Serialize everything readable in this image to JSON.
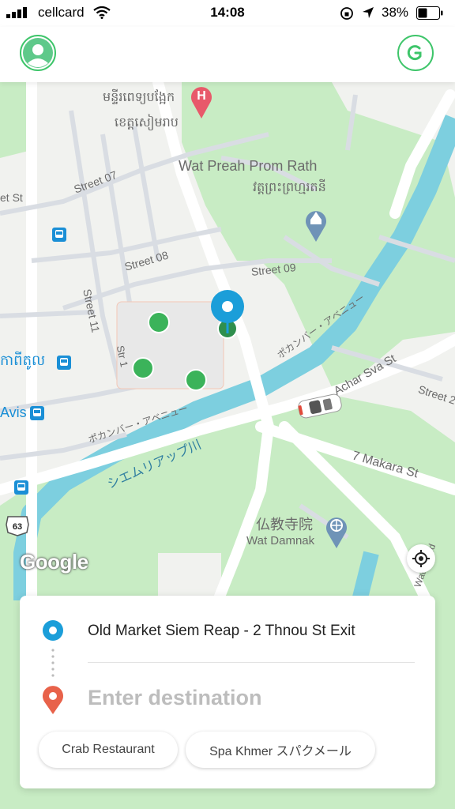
{
  "status_bar": {
    "carrier": "cellcard",
    "time": "14:08",
    "battery": "38%"
  },
  "map": {
    "labels": {
      "hospital_km_1": "មន្ទីរពេទ្យបង្អែក",
      "hospital_km_2": "ខេត្តសៀមរាប",
      "wat_preah_prom_rath": "Wat Preah Prom Rath",
      "wat_preah_prom_rath_km": "វត្តព្រះព្រហ្មរតនី",
      "street_07": "Street 07",
      "street_08": "Street 08",
      "street_09": "Street 09",
      "street_11": "Street 11",
      "st_left": "et St",
      "kaptikol": "កាពីតូល",
      "avis": "Avis",
      "pokambor_1": "ポカンバー・アベニュー",
      "pokambor_2": "ポカンバー・アベニュー",
      "river": "シエムリアップ川",
      "achar_sva": "Achar Sva St",
      "street_right": "Street 2",
      "makara": "7 Makara St",
      "wat_damnak_jp": "仏教寺院",
      "wat_damnak": "Wat Damnak",
      "wat_rd": "Wat Bo Rd",
      "route_63": "63",
      "str_small": "Str 1"
    },
    "google_logo": "Google"
  },
  "card": {
    "pickup": "Old Market Siem Reap - 2 Thnou St Exit",
    "destination_placeholder": "Enter destination",
    "suggestions": [
      "Crab Restaurant",
      "Spa Khmer スパクメール"
    ]
  },
  "colors": {
    "accent_green": "#3ec56a",
    "pickup_blue": "#1b9ed9",
    "dest_red": "#e8624a",
    "river": "#7dcfdf",
    "park": "#c8ecc4"
  },
  "icons": {
    "profile": "person-icon",
    "grab": "grab-logo-icon",
    "hospital": "hospital-icon",
    "temple": "temple-icon",
    "bus": "bus-stop-icon",
    "locate": "crosshair-icon"
  }
}
